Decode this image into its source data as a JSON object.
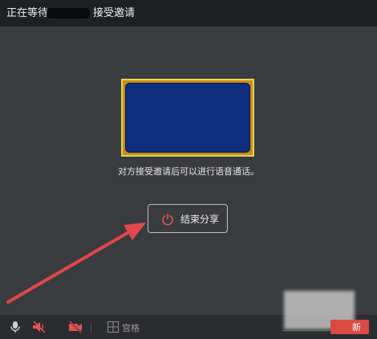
{
  "titlebar": {
    "prefix": "正在等待",
    "suffix": "接受邀请"
  },
  "main": {
    "info_text": "对方接受邀请后可以进行语音通话。",
    "end_share_label": "结束分享"
  },
  "toolbar": {
    "grid_label": "宫格",
    "end_button_partial": "新",
    "icons": [
      "microphone-icon",
      "speaker-muted-icon",
      "camera-off-icon",
      "grid-icon",
      "power-icon"
    ]
  },
  "colors": {
    "accent_red": "#d84a43",
    "arrow_red": "#e2474a",
    "preview_blue": "#0e2d7c",
    "preview_border_yellow": "#e1d35a"
  }
}
